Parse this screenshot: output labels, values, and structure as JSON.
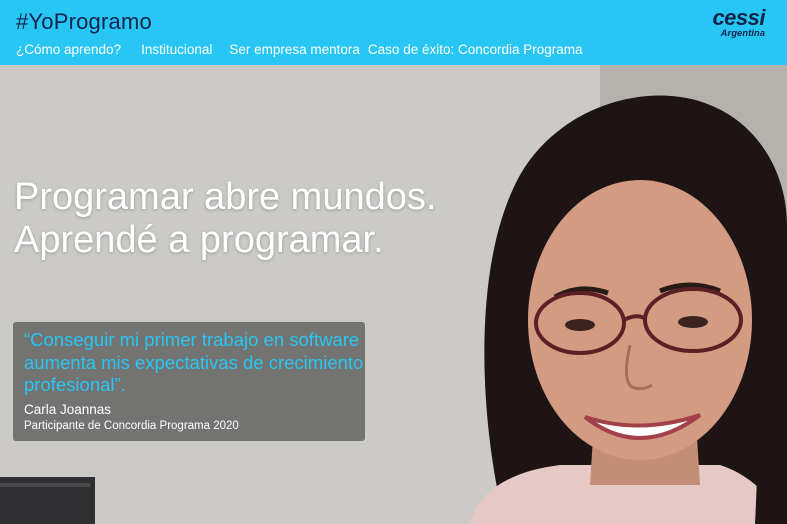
{
  "header": {
    "brand": "#YoProgramo",
    "nav": [
      "¿Cómo aprendo?",
      "Institucional",
      "Ser empresa mentora",
      "Caso de éxito: Concordia Programa"
    ],
    "logo": {
      "main": "cessi",
      "sub": "Argentina",
      "icon": "cessi-logo"
    }
  },
  "hero": {
    "headline_line1": "Programar abre mundos.",
    "headline_line2": "Aprendé a programar.",
    "quote": {
      "text": "“Conseguir mi primer trabajo en software aumenta mis expectativas de crecimiento profesional”.",
      "author": "Carla Joannas",
      "role": "Participante de Concordia Programa 2020"
    },
    "image": "smiling-woman-with-glasses-photo"
  },
  "colors": {
    "navbar": "#27c6f4",
    "brand_text": "#10244a",
    "quote_text": "#27c6f4",
    "quote_box": "#5f5f5f"
  }
}
